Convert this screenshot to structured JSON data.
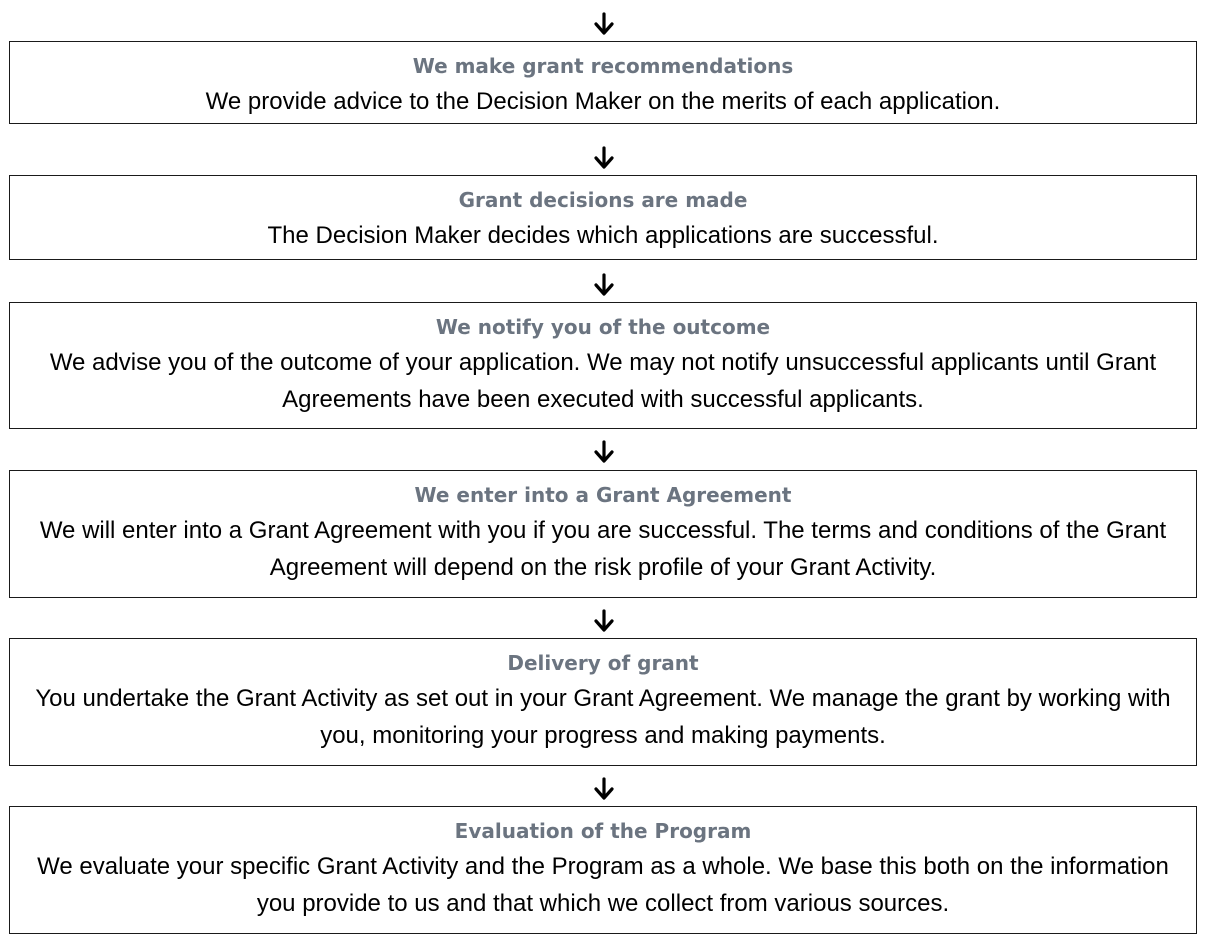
{
  "accent_colors": {
    "title": "#6b7480",
    "text": "#000000",
    "border": "#1a1a1a"
  },
  "arrow_icon": "down-arrow-icon",
  "steps": [
    {
      "title": "We make grant recommendations",
      "text": "We provide advice to the Decision Maker on the merits of each application."
    },
    {
      "title": "Grant decisions are made",
      "text": "The Decision Maker decides which applications are successful."
    },
    {
      "title": "We notify you of the outcome",
      "text": "We advise you of the outcome of your application. We may not notify unsuccessful applicants until Grant Agreements have been executed with successful applicants."
    },
    {
      "title": "We enter into a Grant Agreement",
      "text": "We will enter into a Grant Agreement with you if you are successful. The terms and conditions of the Grant Agreement will depend on the risk profile of your Grant Activity."
    },
    {
      "title": "Delivery of grant",
      "text": "You undertake the Grant Activity as set out in your Grant Agreement. We manage the grant by working with you, monitoring your progress and making payments."
    },
    {
      "title": "Evaluation of the Program",
      "text": "We evaluate your specific Grant Activity and the Program as a whole. We base this both on the information you provide to us and that which we collect from various sources."
    }
  ]
}
